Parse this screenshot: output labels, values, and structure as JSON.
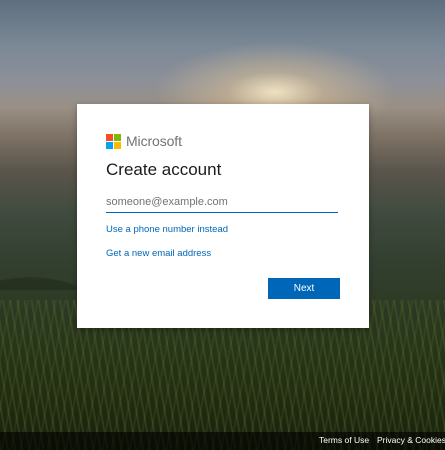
{
  "background": {
    "description": "landscape-photo"
  },
  "brand": {
    "name": "Microsoft",
    "logo_colors": [
      "#f25022",
      "#7fba00",
      "#00a4ef",
      "#ffb900"
    ]
  },
  "form": {
    "title": "Create account",
    "email": {
      "value": "",
      "placeholder": "someone@example.com"
    },
    "phone_link": "Use a phone number instead",
    "new_email_link": "Get a new email address",
    "next_label": "Next"
  },
  "footer": {
    "terms": "Terms of Use",
    "privacy": "Privacy & Cookies"
  },
  "colors": {
    "accent": "#0067b8",
    "card": "#ffffff",
    "heading": "#1b1b1b",
    "placeholder": "#737373"
  }
}
